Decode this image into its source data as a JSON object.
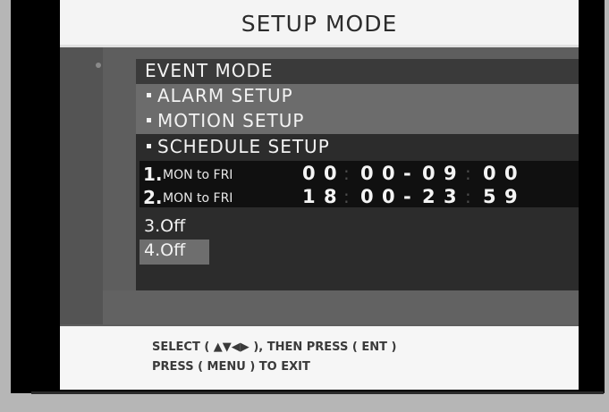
{
  "title": "SETUP MODE",
  "menu": {
    "event_mode": "EVENT MODE",
    "alarm_setup": "ALARM SETUP",
    "motion_setup": "MOTION SETUP",
    "schedule_setup": "SCHEDULE SETUP"
  },
  "schedule": [
    {
      "num": "1.",
      "days": "MON to FRI",
      "start_h": [
        "0",
        "0"
      ],
      "start_m": [
        "0",
        "0"
      ],
      "end_h": [
        "0",
        "9"
      ],
      "end_m": [
        "0",
        "0"
      ]
    },
    {
      "num": "2.",
      "days": "MON to FRI",
      "start_h": [
        "1",
        "8"
      ],
      "start_m": [
        "0",
        "0"
      ],
      "end_h": [
        "2",
        "3"
      ],
      "end_m": [
        "5",
        "9"
      ]
    }
  ],
  "off_entries": [
    "3.Off",
    "4.Off"
  ],
  "help": {
    "line1": "SELECT ( ▲▼◀▶ ), THEN PRESS ( ENT )",
    "line2": "PRESS ( MENU ) TO EXIT"
  },
  "separators": {
    "colon": ":",
    "dash": "-"
  }
}
